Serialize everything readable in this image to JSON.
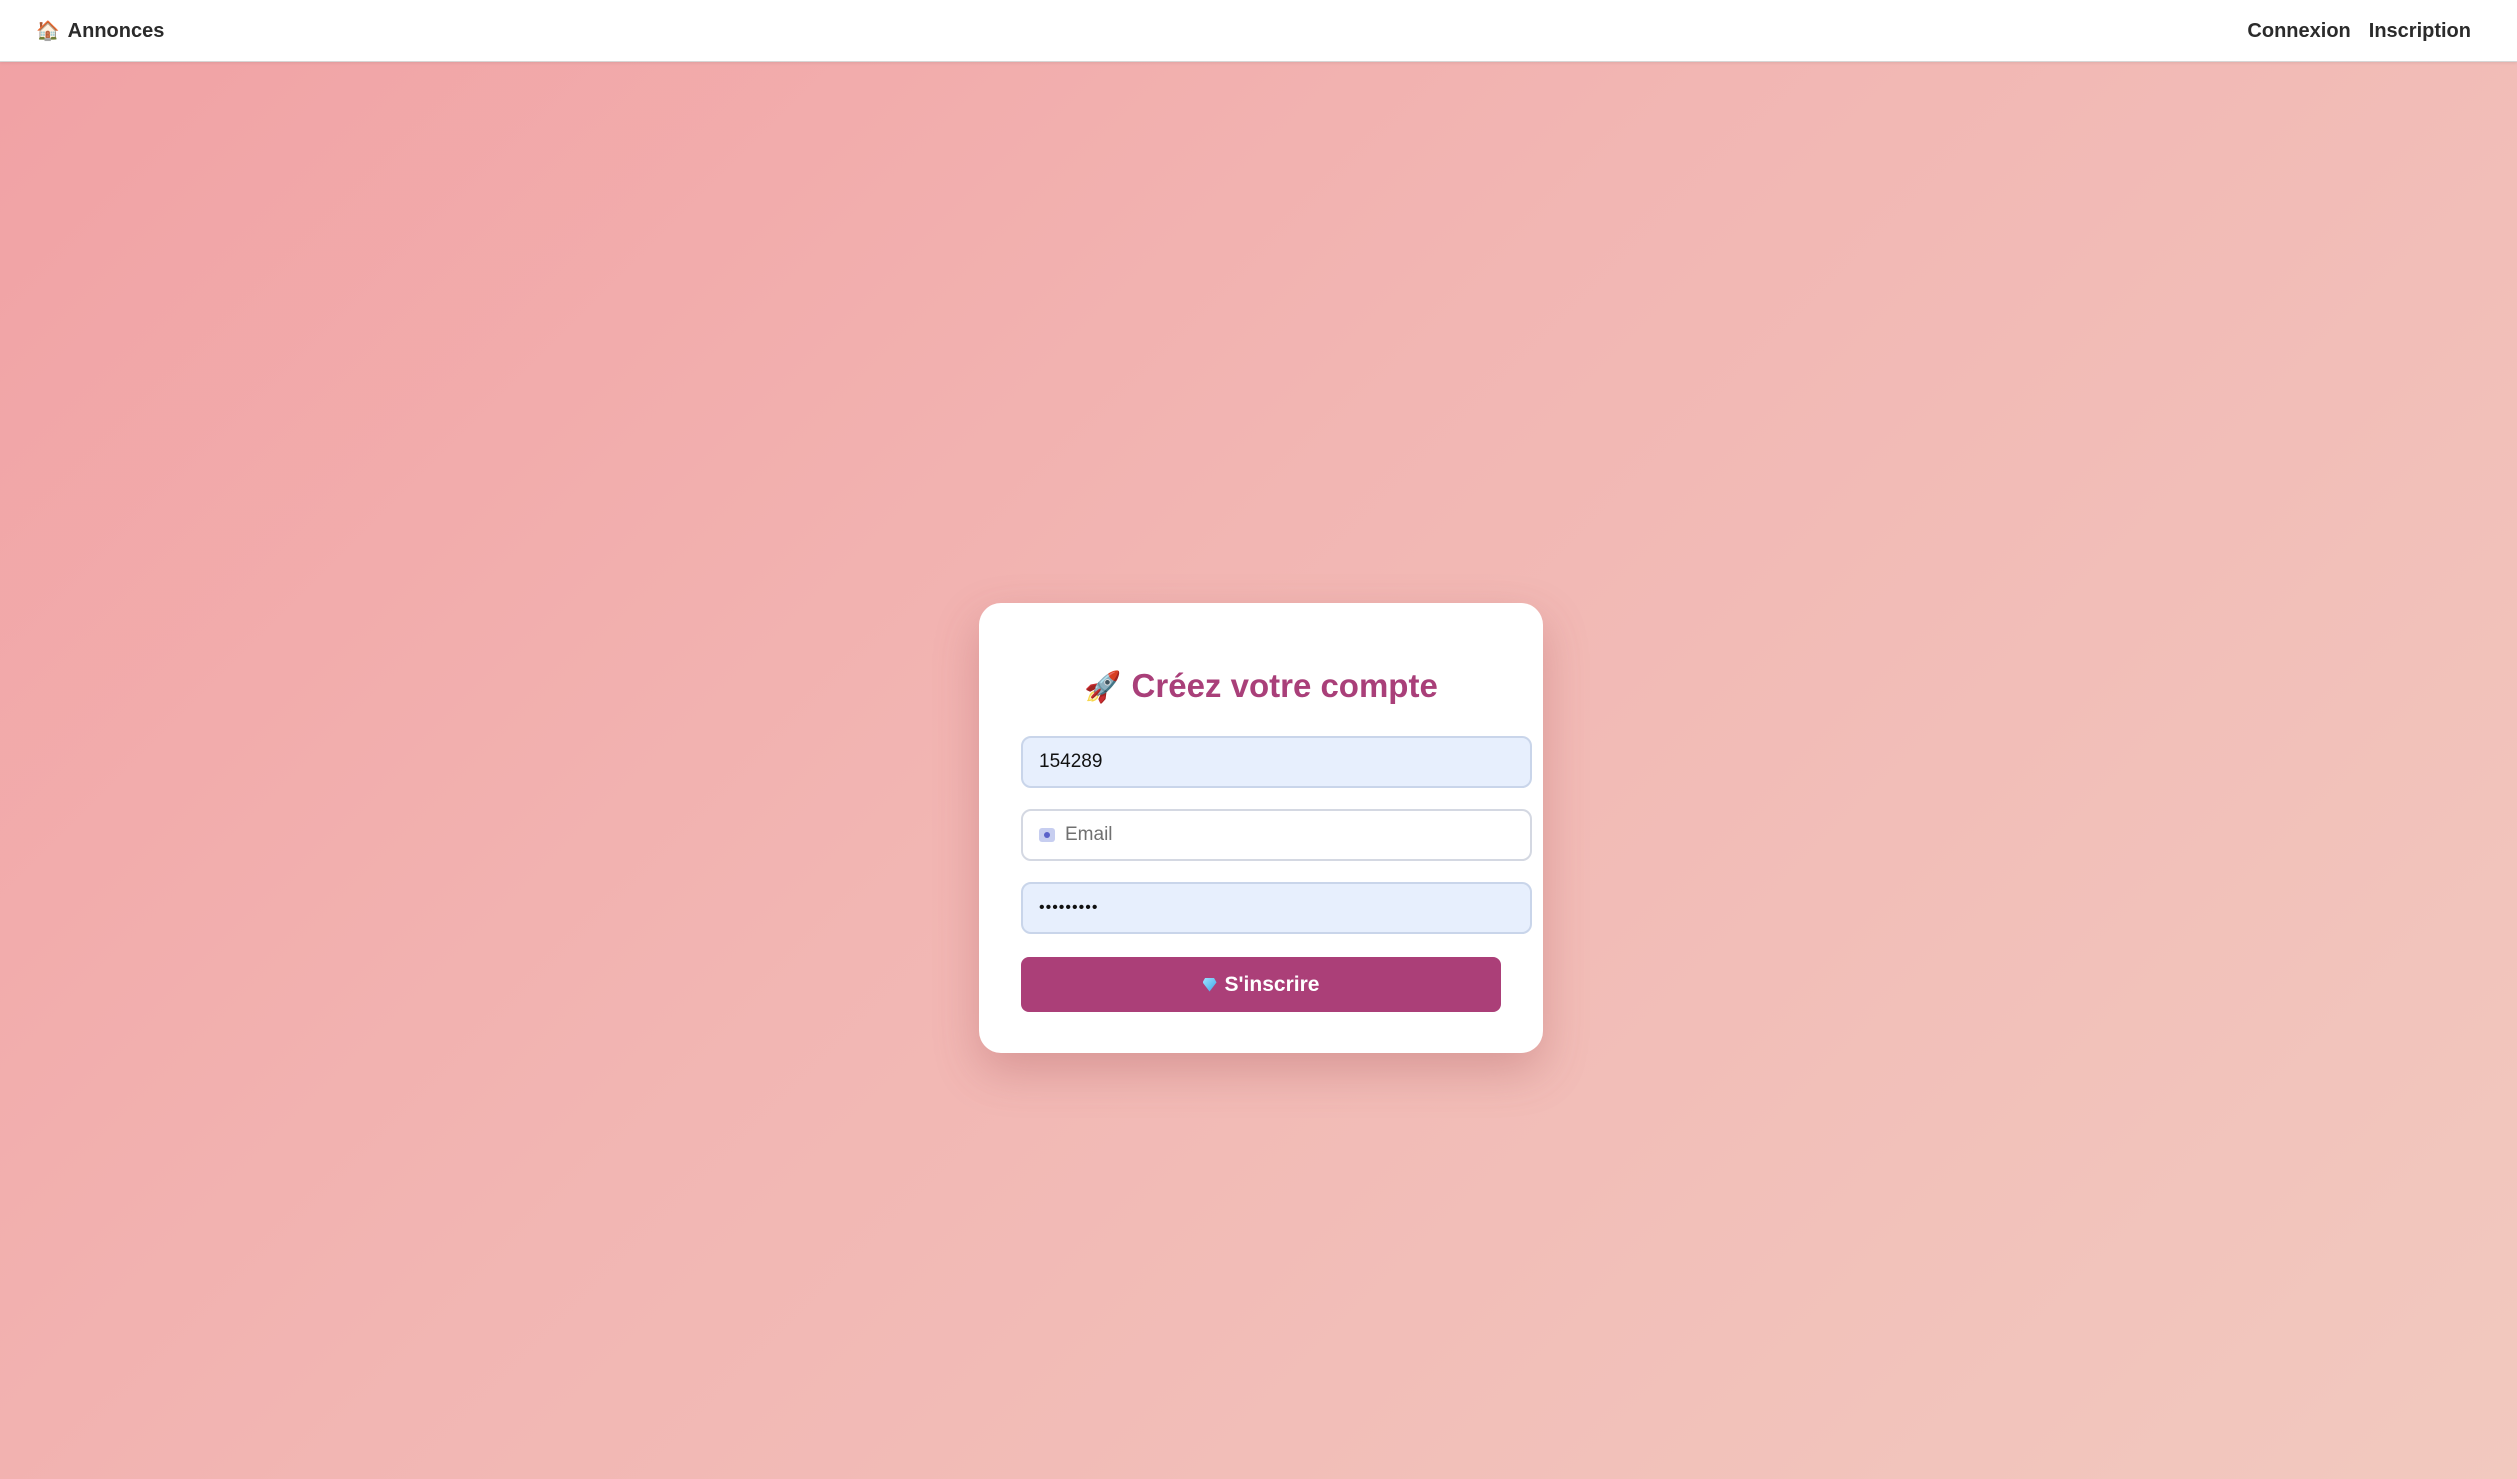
{
  "navbar": {
    "brand": {
      "icon": "house-icon",
      "icon_glyph": "🏠",
      "label": "Annonces"
    },
    "links": [
      {
        "label": "Connexion"
      },
      {
        "label": "Inscription"
      }
    ]
  },
  "signup_form": {
    "title_icon": "rocket-icon",
    "title_icon_glyph": "🚀",
    "title": "Créez votre compte",
    "username_value": "154289",
    "email_placeholder": "Email",
    "email_icon": "id-card-icon",
    "password_value": "•••••••••",
    "submit_icon": "gem-icon",
    "submit_label": "S'inscrire"
  },
  "colors": {
    "accent": "#ab3f78",
    "title": "#a93f79",
    "background_start": "#f1a1a4",
    "background_end": "#f2c9bf",
    "filled_field": "#e7effd"
  }
}
